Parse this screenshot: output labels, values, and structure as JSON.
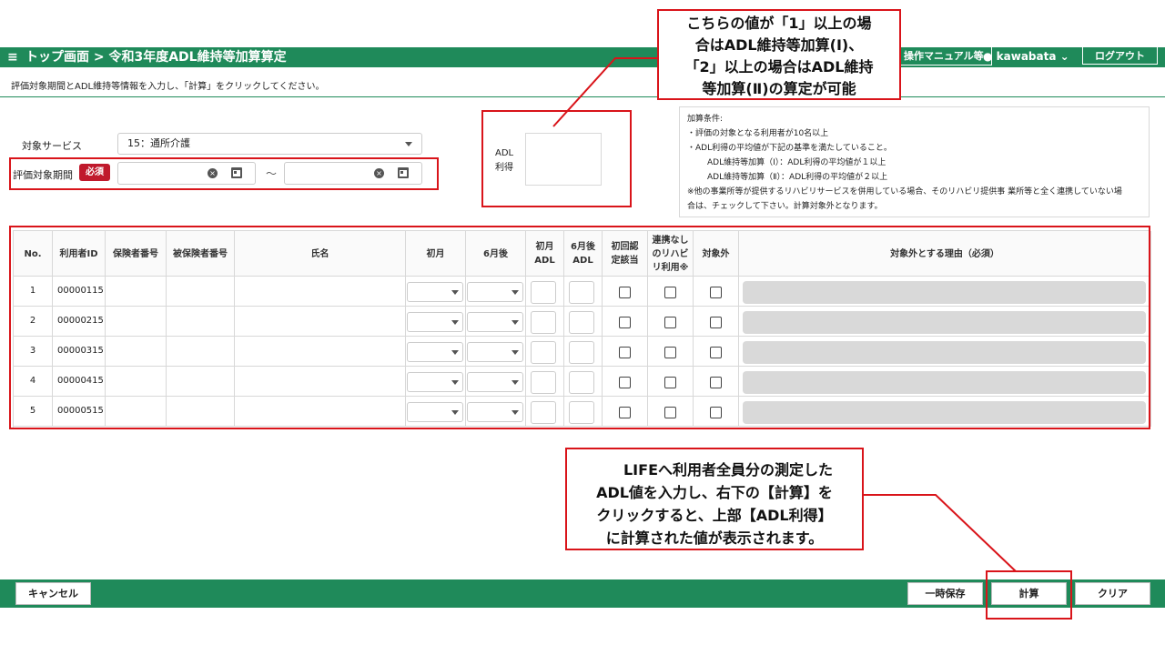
{
  "header": {
    "menu_icon": "≡",
    "breadcrumb": "トップ画面 > 令和3年度ADL維持等加算算定",
    "manual_label": "操作マニュアル等",
    "user_name": "kawabata",
    "logout_label": "ログアウト",
    "theme_color": "#1f8a5a"
  },
  "instruction": "評価対象期間とADL維持等情報を入力し、「計算」をクリックしてください。",
  "form": {
    "service_label": "対象サービス",
    "service_value": "15：通所介護",
    "period_label": "評価対象期間",
    "required_badge": "必須",
    "period_from": "",
    "period_to": "",
    "separator": "～",
    "adl_label_1": "ADL",
    "adl_label_2": "利得",
    "adl_value": ""
  },
  "conditions": {
    "title": "加算条件:",
    "line1": "・評価の対象となる利用者が10名以上",
    "line2": "・ADL利得の平均値が下記の基準を満たしていること。",
    "line3": "ADL維持等加算（Ⅰ）：ADL利得の平均値が１以上",
    "line4": "ADL維持等加算（Ⅱ）：ADL利得の平均値が２以上",
    "line5": "※他の事業所等が提供するリハビリサービスを併用している場合、そのリハビリ提供事 業所等と全く連携していない場",
    "line6": "合は、チェックして下さい。計算対象外となります。"
  },
  "table": {
    "headers": {
      "no": "No.",
      "user_id": "利用者ID",
      "insurer_no": "保険者番号",
      "insured_no": "被保険者番号",
      "name": "氏名",
      "first_month": "初月",
      "sixth_month": "6月後",
      "first_adl_1": "初月",
      "first_adl_2": "ADL",
      "sixth_adl_1": "6月後",
      "sixth_adl_2": "ADL",
      "first_cert_1": "初回認",
      "first_cert_2": "定該当",
      "no_link_1": "連携なし",
      "no_link_2": "のリハビ",
      "no_link_3": "リ利用※",
      "excluded": "対象外",
      "reason": "対象外とする理由（必須）"
    },
    "rows": [
      {
        "no": "1",
        "user_id": "00000115"
      },
      {
        "no": "2",
        "user_id": "00000215"
      },
      {
        "no": "3",
        "user_id": "00000315"
      },
      {
        "no": "4",
        "user_id": "00000415"
      },
      {
        "no": "5",
        "user_id": "00000515"
      }
    ]
  },
  "callout_top": {
    "line1": "こちらの値が「1」以上の場",
    "line2": "合はADL維持等加算(Ⅰ)、",
    "line3": "「2」以上の場合はADL維持",
    "line4": "等加算(Ⅱ)の算定が可能"
  },
  "callout_bottom": {
    "line1": "LIFEへ利用者全員分の測定した",
    "line2": "ADL値を入力し、右下の【計算】を",
    "line3": "クリックすると、上部【ADL利得】",
    "line4": "に計算された値が表示されます。"
  },
  "footer": {
    "cancel_label": "キャンセル",
    "temp_save_label": "一時保存",
    "calc_label": "計算",
    "clear_label": "クリア"
  },
  "highlight_color": "#d9141a"
}
